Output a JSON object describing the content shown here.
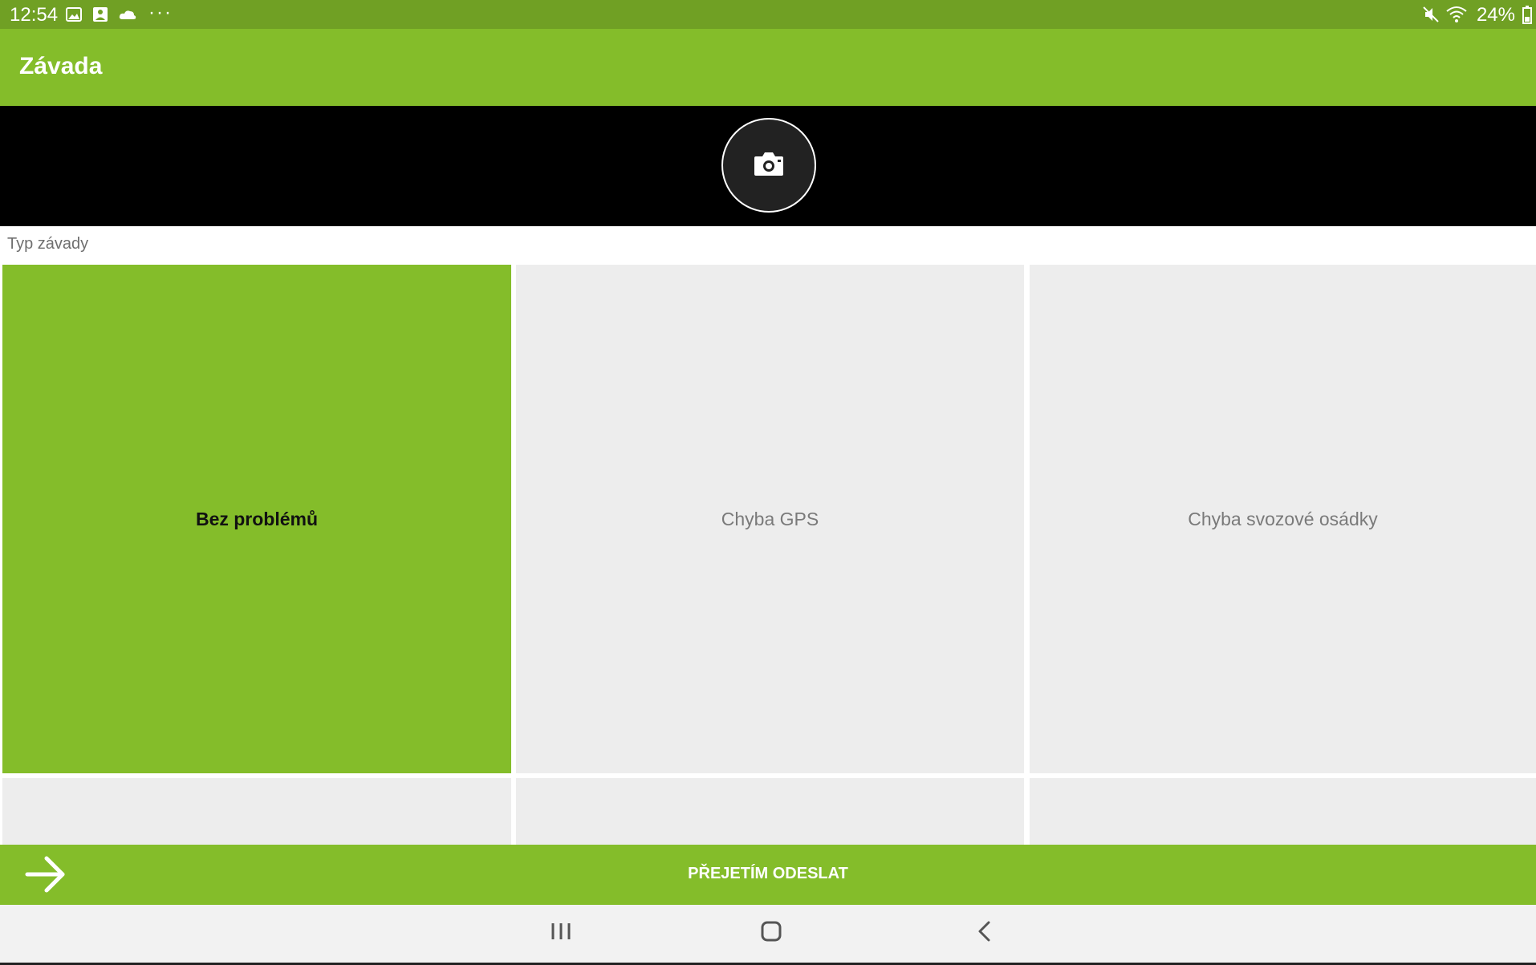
{
  "status_bar": {
    "time": "12:54",
    "battery": "24%",
    "left_icons": [
      "image-icon",
      "gallery-icon",
      "cloud-icon"
    ],
    "right_icons": [
      "mute-icon",
      "wifi-icon",
      "battery-icon"
    ],
    "more": "···"
  },
  "app_bar": {
    "title": "Závada"
  },
  "camera": {
    "icon": "camera-icon"
  },
  "section": {
    "label": "Typ závady"
  },
  "fault_types": [
    {
      "label": "Bez problémů",
      "selected": true
    },
    {
      "label": "Chyba GPS",
      "selected": false
    },
    {
      "label": "Chyba svozové osádky",
      "selected": false
    },
    {
      "label": "",
      "selected": false
    },
    {
      "label": "",
      "selected": false
    },
    {
      "label": "",
      "selected": false
    }
  ],
  "bottom_action": {
    "label": "PŘEJETÍM ODESLAT",
    "icon": "arrow-right-icon"
  },
  "navigation": {
    "icons": [
      "recent-apps-icon",
      "home-icon",
      "back-icon"
    ]
  },
  "colors": {
    "status_bar": "#70a024",
    "primary": "#84bd2a",
    "tile_bg": "#ededed",
    "camera_bg": "#000000"
  }
}
